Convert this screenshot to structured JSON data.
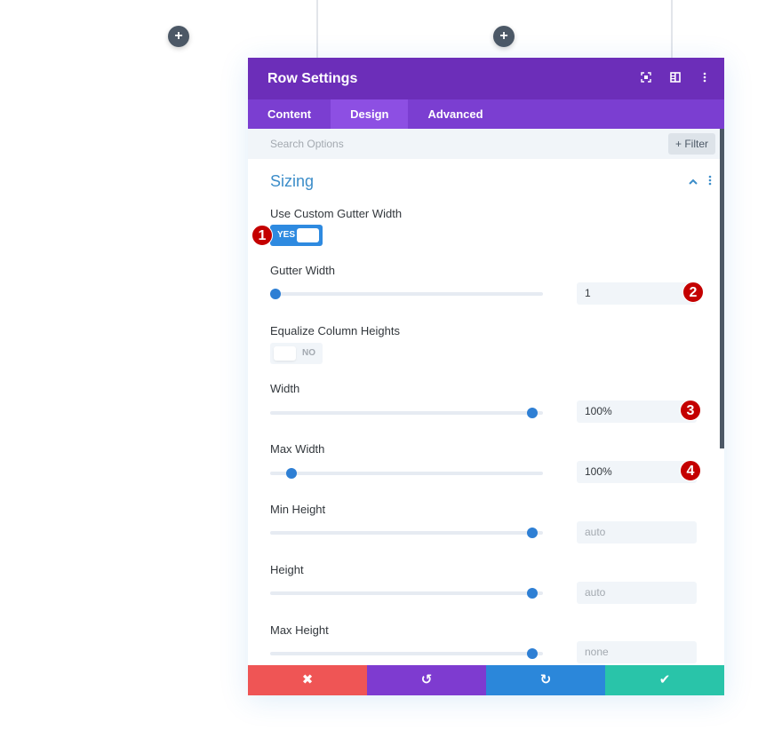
{
  "background": {
    "add_buttons": [
      {
        "label": "+",
        "name": "add-column-button-left"
      },
      {
        "label": "+",
        "name": "add-column-button-middle"
      }
    ]
  },
  "modal": {
    "title": "Row Settings",
    "header_icons": [
      "fullscreen-icon",
      "split-view-icon",
      "more-options-icon"
    ],
    "tabs": [
      {
        "label": "Content",
        "active": false
      },
      {
        "label": "Design",
        "active": true
      },
      {
        "label": "Advanced",
        "active": false
      }
    ],
    "search": {
      "placeholder": "Search Options",
      "filter_label": "+ Filter"
    },
    "section": {
      "title": "Sizing",
      "collapse_icon": "chevron-up-icon",
      "menu_icon": "more-options-icon"
    },
    "options": {
      "custom_gutter": {
        "label": "Use Custom Gutter Width",
        "value": "YES",
        "on": true
      },
      "gutter_width": {
        "label": "Gutter Width",
        "value": "1",
        "slider_fraction": 0.0
      },
      "equalize": {
        "label": "Equalize Column Heights",
        "value": "NO",
        "on": false
      },
      "width": {
        "label": "Width",
        "value": "100%",
        "slider_fraction": 0.98
      },
      "max_width": {
        "label": "Max Width",
        "value": "100%",
        "slider_fraction": 0.06
      },
      "min_height": {
        "label": "Min Height",
        "value": "auto",
        "slider_fraction": 0.98
      },
      "height": {
        "label": "Height",
        "value": "auto",
        "slider_fraction": 0.98
      },
      "max_height": {
        "label": "Max Height",
        "value": "none",
        "slider_fraction": 0.98
      }
    },
    "annotations": [
      "1",
      "2",
      "3",
      "4"
    ],
    "footer": {
      "cancel": "✖",
      "undo": "↺",
      "redo": "↻",
      "save": "✔"
    }
  },
  "colors": {
    "header": "#6c2eb9",
    "tabs": "#7b3ed1",
    "accent": "#2e8ae0",
    "cancel": "#ef5555",
    "undo": "#7e3bd0",
    "redo": "#2b87da",
    "save": "#29c4a9",
    "annotation": "#c40000"
  }
}
